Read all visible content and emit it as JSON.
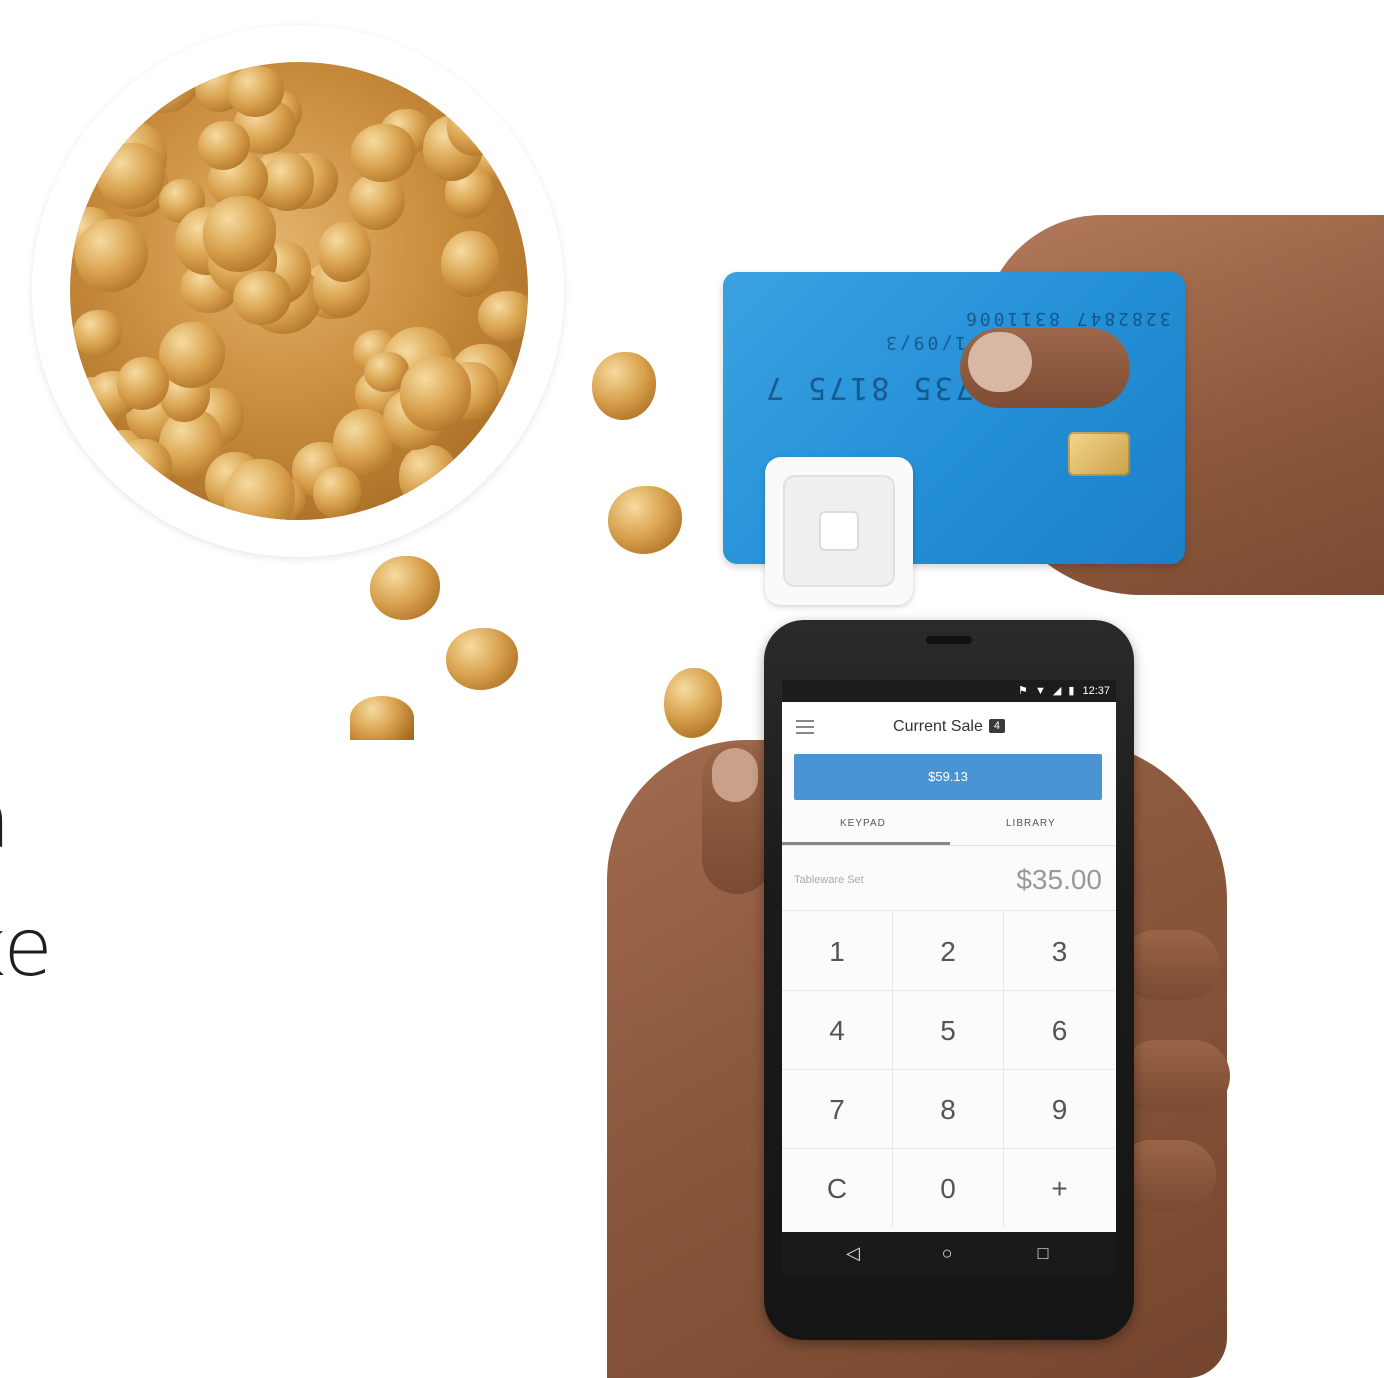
{
  "background_text": {
    "line1": "n",
    "line2": "ke"
  },
  "phone": {
    "status": {
      "icons": "⚑ ▼ ◢ ▮",
      "time": "12:37"
    },
    "app": {
      "title": "Current Sale",
      "badge_count": "4",
      "charge_amount": "$59.13",
      "tabs": {
        "keypad": "KEYPAD",
        "library": "LIBRARY"
      },
      "entry": {
        "label": "Tableware Set",
        "amount": "$35.00"
      },
      "keys": [
        "1",
        "2",
        "3",
        "4",
        "5",
        "6",
        "7",
        "8",
        "9",
        "C",
        "0",
        "+"
      ]
    },
    "nav": {
      "back": "◁",
      "home": "○",
      "recents": "□"
    }
  },
  "card": {
    "number_fragment_1": "3282847 8311006",
    "number_fragment_2": "0735 8175 7",
    "number_fragment_3": "1/09/3"
  },
  "colors": {
    "card_blue": "#238fd6",
    "charge_button": "#4b94d4",
    "popcorn": "#d9a34f"
  }
}
